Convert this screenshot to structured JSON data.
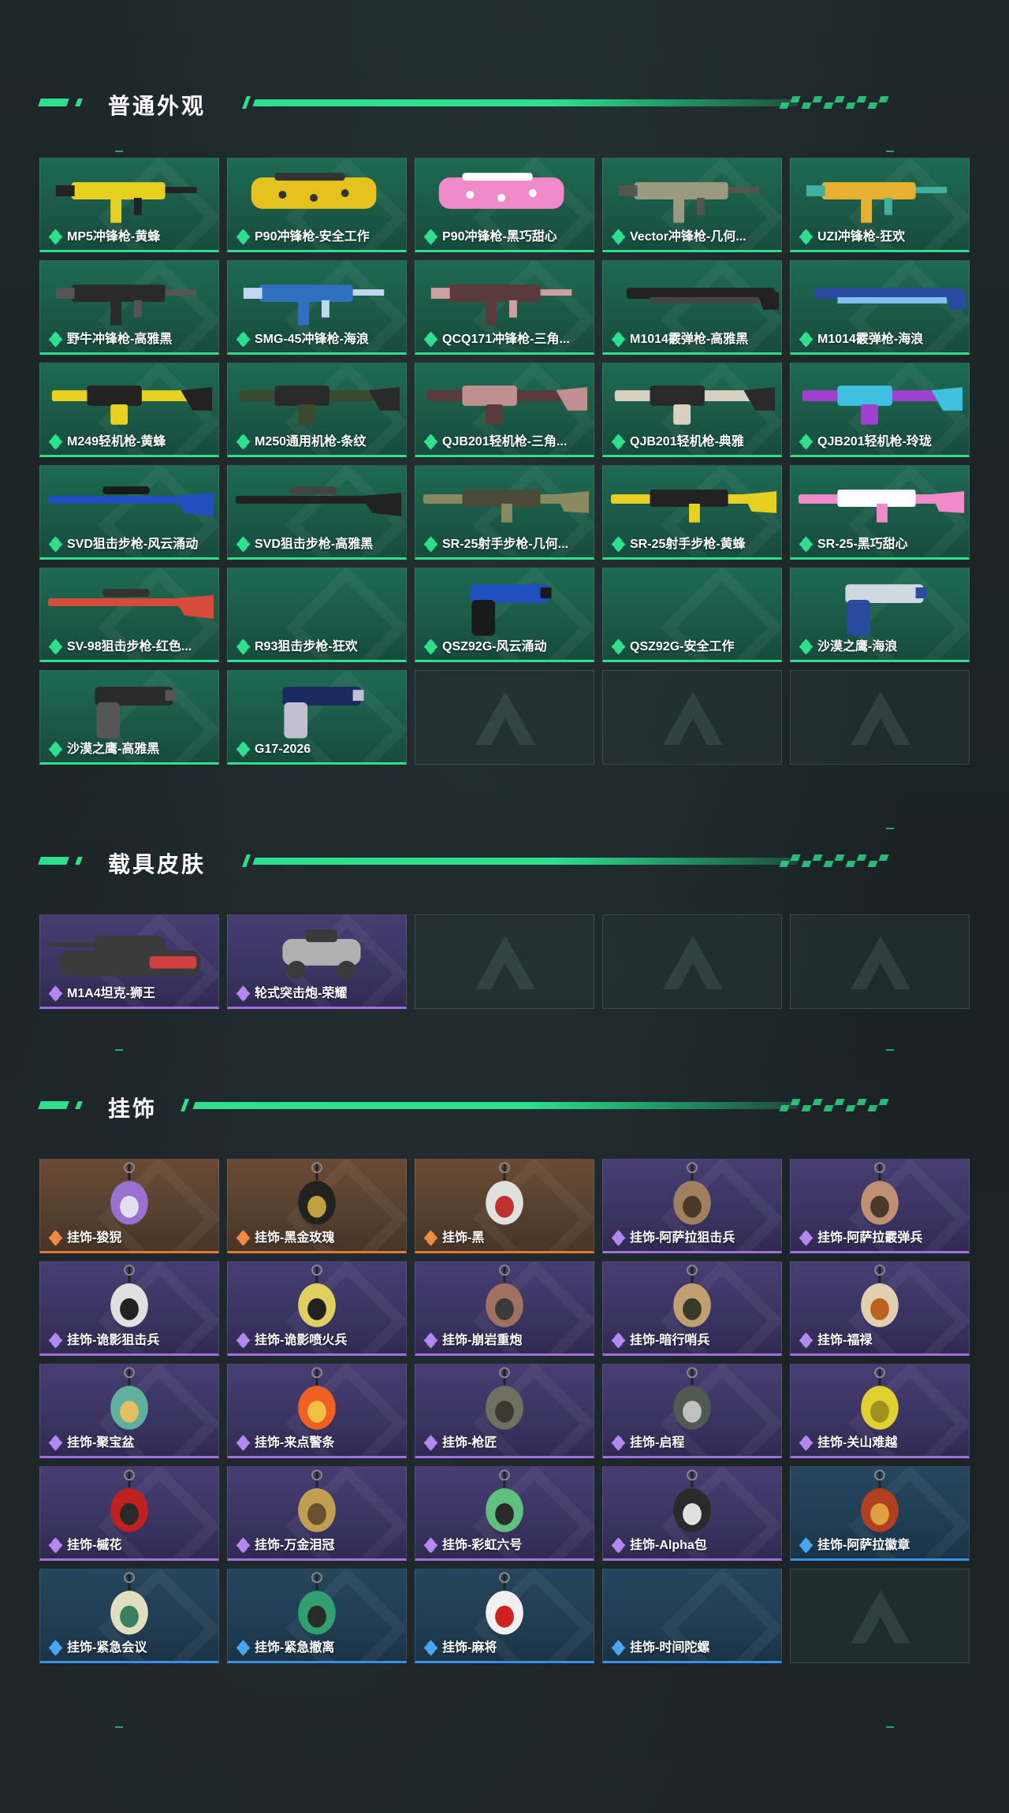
{
  "sections": {
    "weapons": {
      "title": "普通外观",
      "items": [
        {
          "name": "MP5冲锋枪-黄蜂",
          "rarity": "green",
          "icon": "smg-icon",
          "c1": "#e8d020",
          "c2": "#222222"
        },
        {
          "name": "P90冲锋枪-安全工作",
          "rarity": "green",
          "icon": "p90-icon",
          "c1": "#e6c21e",
          "c2": "#333333"
        },
        {
          "name": "P90冲锋枪-黑巧甜心",
          "rarity": "green",
          "icon": "p90-icon",
          "c1": "#f08ac8",
          "c2": "#ffffff"
        },
        {
          "name": "Vector冲锋枪-几何...",
          "rarity": "green",
          "icon": "smg-icon",
          "c1": "#9a9a80",
          "c2": "#555550"
        },
        {
          "name": "UZI冲锋枪-狂欢",
          "rarity": "green",
          "icon": "smg-icon",
          "c1": "#e8b030",
          "c2": "#40b0a0"
        },
        {
          "name": "野牛冲锋枪-高雅黑",
          "rarity": "green",
          "icon": "smg-icon",
          "c1": "#2a2a2a",
          "c2": "#555555"
        },
        {
          "name": "SMG-45冲锋枪-海浪",
          "rarity": "green",
          "icon": "smg-icon",
          "c1": "#3070c0",
          "c2": "#c0d8f0"
        },
        {
          "name": "QCQ171冲锋枪-三角...",
          "rarity": "green",
          "icon": "smg-icon",
          "c1": "#5a3a3a",
          "c2": "#d0a0a0"
        },
        {
          "name": "M1014霰弹枪-高雅黑",
          "rarity": "green",
          "icon": "shotgun-icon",
          "c1": "#222222",
          "c2": "#444444"
        },
        {
          "name": "M1014霰弹枪-海浪",
          "rarity": "green",
          "icon": "shotgun-icon",
          "c1": "#2a4aa0",
          "c2": "#80c0f0"
        },
        {
          "name": "M249轻机枪-黄蜂",
          "rarity": "green",
          "icon": "lmg-icon",
          "c1": "#e8d020",
          "c2": "#222222"
        },
        {
          "name": "M250通用机枪-条纹",
          "rarity": "green",
          "icon": "lmg-icon",
          "c1": "#3a4a30",
          "c2": "#2a2a2a"
        },
        {
          "name": "QJB201轻机枪-三角...",
          "rarity": "green",
          "icon": "lmg-icon",
          "c1": "#5a3a3a",
          "c2": "#c09090"
        },
        {
          "name": "QJB201轻机枪-典雅",
          "rarity": "green",
          "icon": "lmg-icon",
          "c1": "#d8d0c0",
          "c2": "#2a2a2a"
        },
        {
          "name": "QJB201轻机枪-玲珑",
          "rarity": "green",
          "icon": "lmg-icon",
          "c1": "#a040d0",
          "c2": "#40c0e0"
        },
        {
          "name": "SVD狙击步枪-风云涌动",
          "rarity": "green",
          "icon": "sniper-icon",
          "c1": "#2050c0",
          "c2": "#1a1a1a"
        },
        {
          "name": "SVD狙击步枪-高雅黑",
          "rarity": "green",
          "icon": "sniper-icon",
          "c1": "#222222",
          "c2": "#444444"
        },
        {
          "name": "SR-25射手步枪-几何...",
          "rarity": "green",
          "icon": "rifle-icon",
          "c1": "#8a8a60",
          "c2": "#4a4a3a"
        },
        {
          "name": "SR-25射手步枪-黄蜂",
          "rarity": "green",
          "icon": "rifle-icon",
          "c1": "#e8d020",
          "c2": "#222222"
        },
        {
          "name": "SR-25-黑巧甜心",
          "rarity": "green",
          "icon": "rifle-icon",
          "c1": "#f08ac8",
          "c2": "#ffffff"
        },
        {
          "name": "SV-98狙击步枪-红色...",
          "rarity": "green",
          "icon": "sniper-icon",
          "c1": "#d84a3a",
          "c2": "#333333"
        },
        {
          "name": "R93狙击步枪-狂欢",
          "rarity": "green",
          "icon": "none",
          "c1": "",
          "c2": ""
        },
        {
          "name": "QSZ92G-风云涌动",
          "rarity": "green",
          "icon": "pistol-icon",
          "c1": "#2050c0",
          "c2": "#1a1a1a"
        },
        {
          "name": "QSZ92G-安全工作",
          "rarity": "green",
          "icon": "none",
          "c1": "",
          "c2": ""
        },
        {
          "name": "沙漠之鹰-海浪",
          "rarity": "green",
          "icon": "pistol-icon",
          "c1": "#d0d8e0",
          "c2": "#2a4aa0"
        },
        {
          "name": "沙漠之鹰-高雅黑",
          "rarity": "green",
          "icon": "pistol-icon",
          "c1": "#2a2a2a",
          "c2": "#555555"
        },
        {
          "name": "G17-2026",
          "rarity": "green",
          "icon": "pistol-icon",
          "c1": "#1a2a60",
          "c2": "#c0c0d0"
        },
        {
          "name": "",
          "rarity": "empty"
        },
        {
          "name": "",
          "rarity": "empty"
        },
        {
          "name": "",
          "rarity": "empty"
        }
      ]
    },
    "vehicles": {
      "title": "载具皮肤",
      "items": [
        {
          "name": "M1A4坦克-狮王",
          "rarity": "purple",
          "icon": "tank-icon",
          "c1": "#3a3a3a",
          "c2": "#d04040"
        },
        {
          "name": "轮式突击炮-荣耀",
          "rarity": "purple",
          "icon": "armored-car-icon",
          "c1": "#b0b0b0",
          "c2": "#3a3a3a"
        },
        {
          "name": "",
          "rarity": "empty"
        },
        {
          "name": "",
          "rarity": "empty"
        },
        {
          "name": "",
          "rarity": "empty"
        }
      ]
    },
    "charms": {
      "title": "挂饰",
      "items": [
        {
          "name": "挂饰-狻猊",
          "rarity": "orange",
          "icon": "charm-icon",
          "c1": "#9a70d0",
          "c2": "#e0e0f0"
        },
        {
          "name": "挂饰-黑金玫瑰",
          "rarity": "orange",
          "icon": "charm-icon",
          "c1": "#222222",
          "c2": "#c0a040"
        },
        {
          "name": "挂饰-黑",
          "rarity": "orange",
          "icon": "charm-icon",
          "c1": "#e0e0e0",
          "c2": "#c03030"
        },
        {
          "name": "挂饰-阿萨拉狙击兵",
          "rarity": "purple",
          "icon": "charm-icon",
          "c1": "#a08060",
          "c2": "#4a3a2a"
        },
        {
          "name": "挂饰-阿萨拉霰弹兵",
          "rarity": "purple",
          "icon": "charm-icon",
          "c1": "#c09070",
          "c2": "#4a3a2a"
        },
        {
          "name": "挂饰-诡影狙击兵",
          "rarity": "purple",
          "icon": "charm-icon",
          "c1": "#e0e0e0",
          "c2": "#222222"
        },
        {
          "name": "挂饰-诡影喷火兵",
          "rarity": "purple",
          "icon": "charm-icon",
          "c1": "#e0d060",
          "c2": "#222222"
        },
        {
          "name": "挂饰-崩岩重炮",
          "rarity": "purple",
          "icon": "charm-icon",
          "c1": "#a07060",
          "c2": "#3a3a3a"
        },
        {
          "name": "挂饰-暗行哨兵",
          "rarity": "purple",
          "icon": "charm-icon",
          "c1": "#c0a070",
          "c2": "#3a3a2a"
        },
        {
          "name": "挂饰-福禄",
          "rarity": "purple",
          "icon": "charm-icon",
          "c1": "#e0d0b0",
          "c2": "#c06020"
        },
        {
          "name": "挂饰-聚宝盆",
          "rarity": "purple",
          "icon": "charm-icon",
          "c1": "#60b0a0",
          "c2": "#e0c060"
        },
        {
          "name": "挂饰-来点警条",
          "rarity": "purple",
          "icon": "charm-icon",
          "c1": "#f06020",
          "c2": "#f0c040"
        },
        {
          "name": "挂饰-枪匠",
          "rarity": "purple",
          "icon": "charm-icon",
          "c1": "#707060",
          "c2": "#3a3a30"
        },
        {
          "name": "挂饰-启程",
          "rarity": "purple",
          "icon": "charm-icon",
          "c1": "#505a50",
          "c2": "#c0c0c0"
        },
        {
          "name": "挂饰-关山难越",
          "rarity": "purple",
          "icon": "charm-icon",
          "c1": "#e0d030",
          "c2": "#a09020"
        },
        {
          "name": "挂饰-槭花",
          "rarity": "purple",
          "icon": "charm-icon",
          "c1": "#c02020",
          "c2": "#2a2a2a"
        },
        {
          "name": "挂饰-万金泪冠",
          "rarity": "purple",
          "icon": "charm-icon",
          "c1": "#c0a050",
          "c2": "#6a5030"
        },
        {
          "name": "挂饰-彩虹六号",
          "rarity": "purple",
          "icon": "charm-icon",
          "c1": "#60c080",
          "c2": "#2a2a2a"
        },
        {
          "name": "挂饰-Alpha包",
          "rarity": "purple",
          "icon": "charm-icon",
          "c1": "#2a2a2a",
          "c2": "#e0e0e0"
        },
        {
          "name": "挂饰-阿萨拉徽章",
          "rarity": "blue",
          "icon": "charm-icon",
          "c1": "#b04020",
          "c2": "#e0a040"
        },
        {
          "name": "挂饰-紧急会议",
          "rarity": "blue",
          "icon": "charm-icon",
          "c1": "#e0e0c0",
          "c2": "#3a8060"
        },
        {
          "name": "挂饰-紧急撤离",
          "rarity": "blue",
          "icon": "charm-icon",
          "c1": "#30a070",
          "c2": "#2a2a2a"
        },
        {
          "name": "挂饰-麻将",
          "rarity": "blue",
          "icon": "charm-icon",
          "c1": "#f0f0f0",
          "c2": "#d02020"
        },
        {
          "name": "挂饰-时间陀螺",
          "rarity": "blue",
          "icon": "none",
          "c1": "",
          "c2": ""
        },
        {
          "name": "",
          "rarity": "empty"
        }
      ]
    }
  }
}
